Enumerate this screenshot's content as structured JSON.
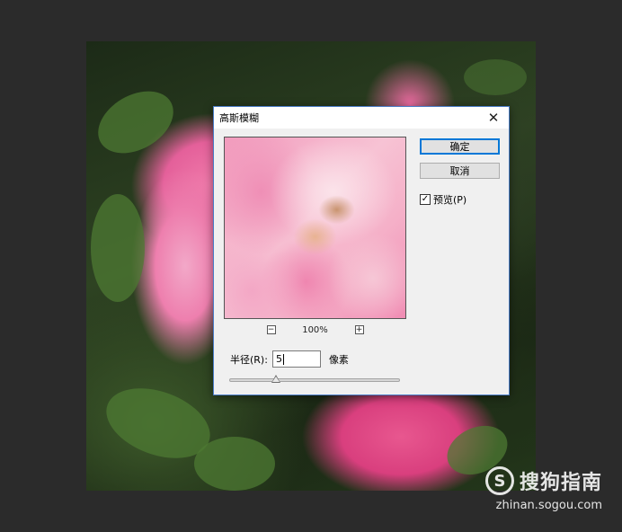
{
  "dialog": {
    "title": "高斯模糊",
    "close_symbol": "✕",
    "buttons": {
      "ok_label": "确定",
      "cancel_label": "取消"
    },
    "preview_checkbox": {
      "label": "预览(P)",
      "checked": true,
      "check_symbol": "✓"
    },
    "zoom": {
      "minus_symbol": "−",
      "plus_symbol": "+",
      "level": "100%"
    },
    "radius": {
      "label": "半径(R):",
      "value": "5",
      "unit": "像素",
      "slider_fraction": 0.27
    }
  },
  "watermark": {
    "logo_letter": "S",
    "name": "搜狗指南",
    "url": "zhinan.sogou.com"
  },
  "colors": {
    "accent": "#0078d7",
    "dialog_border": "#4a7cc7",
    "workspace": "#2b2b2b"
  }
}
